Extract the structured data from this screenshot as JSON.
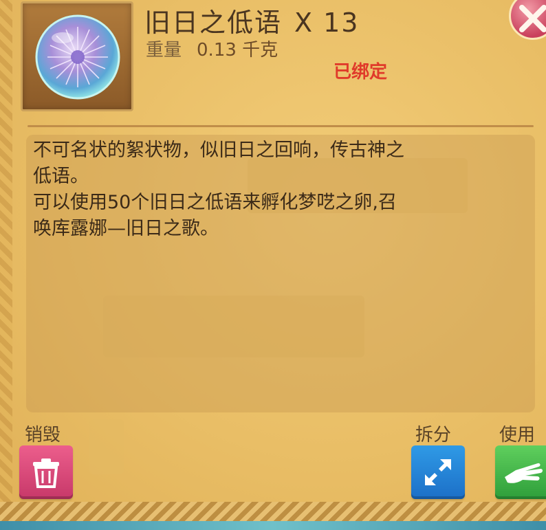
{
  "item": {
    "name": "旧日之低语",
    "quantity": "X 13",
    "weight_label": "重量",
    "weight_value": "0.13 千克",
    "bound_status": "已绑定",
    "icon": "crystal-orb-icon"
  },
  "description": {
    "lines": [
      "不可名状的絮状物，似旧日之回响，传古神之",
      "低语。",
      "可以使用50个旧日之低语来孵化梦呓之卵,召",
      "唤库露娜—旧日之歌。"
    ]
  },
  "actions": {
    "destroy_label": "销毁",
    "split_label": "拆分",
    "use_label": "使用"
  },
  "colors": {
    "bound": "#e03a2a",
    "destroy_button": "#d9466f",
    "split_button": "#2582d6",
    "use_button": "#43b34a",
    "close_button": "#d9566f"
  }
}
